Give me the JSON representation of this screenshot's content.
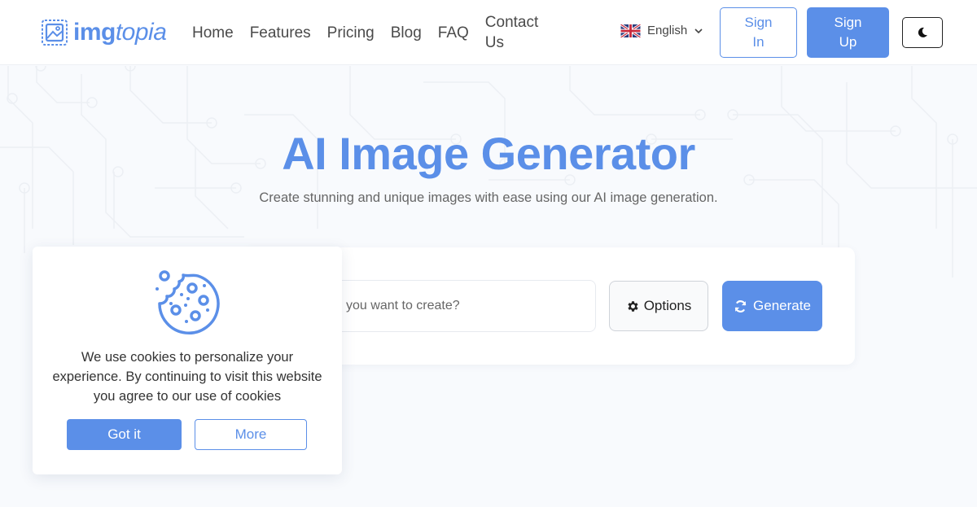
{
  "header": {
    "logo": {
      "text_bold": "img",
      "text_italic": "topia",
      "icon": "image-frame-icon"
    },
    "nav": [
      {
        "label": "Home"
      },
      {
        "label": "Features"
      },
      {
        "label": "Pricing"
      },
      {
        "label": "Blog"
      },
      {
        "label": "FAQ"
      },
      {
        "label": "Contact Us"
      }
    ],
    "language": {
      "flag": "uk-flag-icon",
      "selected": "English",
      "icon": "chevron-down-icon"
    },
    "sign_in_label": "Sign In",
    "sign_up_label": "Sign Up",
    "dark_mode_icon": "moon-icon"
  },
  "hero": {
    "title": "AI Image Generator",
    "subtitle": "Create stunning and unique images with ease using our AI image generation."
  },
  "generator": {
    "prompt_placeholder": "What do you want to create?",
    "options_label": "Options",
    "options_icon": "gear-icon",
    "generate_label": "Generate",
    "generate_icon": "refresh-icon"
  },
  "cookie_banner": {
    "icon": "cookie-icon",
    "message": "We use cookies to personalize your experience. By continuing to visit this website you agree to our use of cookies",
    "accept_label": "Got it",
    "more_label": "More"
  },
  "colors": {
    "brand": "#5b8fe8",
    "background": "#f8fafd",
    "text": "#333333"
  }
}
